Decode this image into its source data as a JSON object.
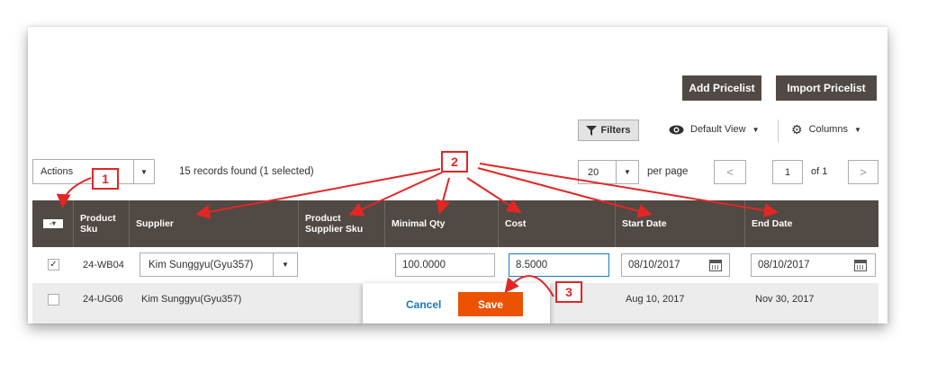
{
  "toolbar": {
    "add_pricelist": "Add Pricelist",
    "import_pricelist": "Import Pricelist",
    "filters": "Filters",
    "default_view": "Default View",
    "columns": "Columns"
  },
  "actions": {
    "label": "Actions",
    "records_text": "15 records found (1 selected)"
  },
  "pagination": {
    "per_page_value": "20",
    "per_page_label": "per page",
    "current_page": "1",
    "of_pages": "of 1",
    "prev": "<",
    "next": ">"
  },
  "table": {
    "headers": {
      "product_sku": "Product Sku",
      "supplier": "Supplier",
      "product_supplier_sku": "Product Supplier Sku",
      "minimal_qty": "Minimal Qty",
      "cost": "Cost",
      "start_date": "Start Date",
      "end_date": "End Date"
    },
    "row1": {
      "checked": "✓",
      "sku": "24-WB04",
      "supplier": "Kim Sunggyu(Gyu357)",
      "minimal_qty": "100.0000",
      "cost": "8.5000",
      "start_date": "08/10/2017",
      "end_date": "08/10/2017"
    },
    "row2": {
      "sku": "24-UG06",
      "supplier": "Kim Sunggyu(Gyu357)",
      "start_date": "Aug 10, 2017",
      "end_date": "Nov 30, 2017"
    }
  },
  "inline_edit": {
    "cancel": "Cancel",
    "save": "Save"
  },
  "annotations": {
    "n1": "1",
    "n2": "2",
    "n3": "3"
  },
  "colors": {
    "header_bg": "#514943",
    "save_orange": "#eb5202",
    "annotation_red": "#e22626",
    "link_blue": "#1979c3"
  }
}
